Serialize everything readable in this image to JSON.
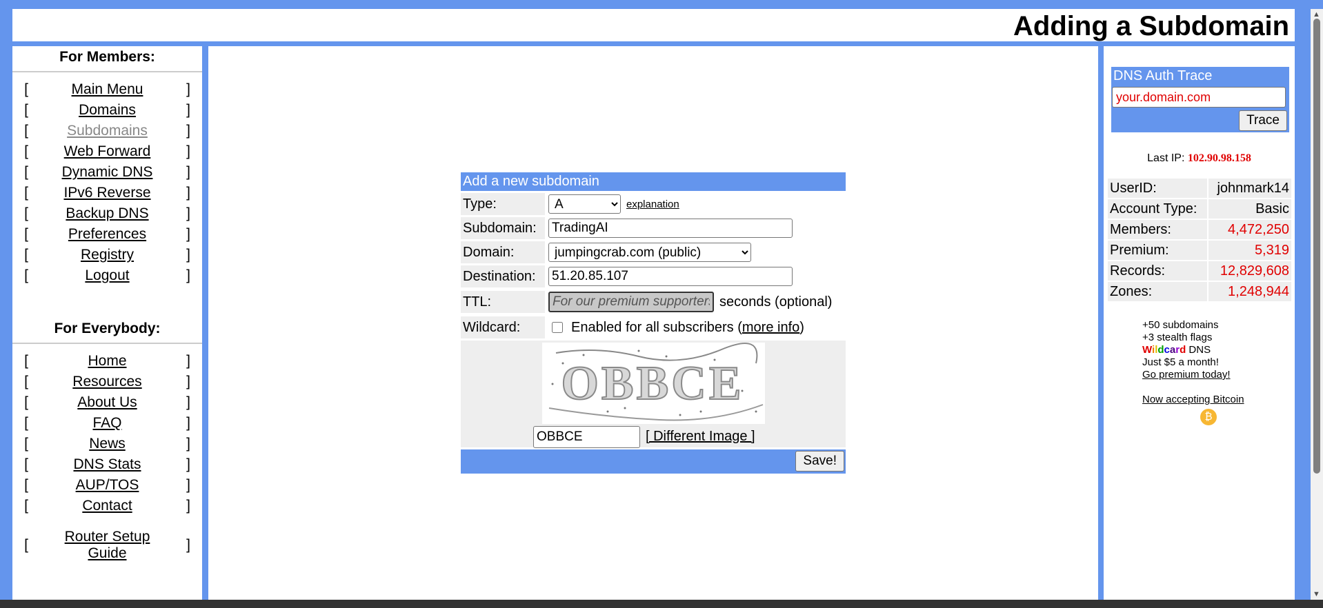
{
  "page_title": "Adding a Subdomain",
  "members_heading": "For Members:",
  "members_nav": [
    {
      "label": "Main Menu"
    },
    {
      "label": "Domains"
    },
    {
      "label": "Subdomains"
    },
    {
      "label": "Web Forward"
    },
    {
      "label": "Dynamic DNS"
    },
    {
      "label": "IPv6 Reverse"
    },
    {
      "label": "Backup DNS"
    },
    {
      "label": "Preferences"
    },
    {
      "label": "Registry"
    },
    {
      "label": "Logout"
    }
  ],
  "everybody_heading": "For Everybody:",
  "everybody_nav": [
    {
      "label": "Home"
    },
    {
      "label": "Resources"
    },
    {
      "label": "About Us"
    },
    {
      "label": "FAQ"
    },
    {
      "label": "News"
    },
    {
      "label": "DNS Stats"
    },
    {
      "label": "AUP/TOS"
    },
    {
      "label": "Contact"
    },
    {
      "label": "Router Setup Guide"
    }
  ],
  "bracket_open": "[",
  "bracket_close": "]",
  "form": {
    "header": "Add a new subdomain",
    "type_label": "Type:",
    "type_value": "A",
    "explanation_link": "explanation",
    "subdomain_label": "Subdomain:",
    "subdomain_value": "TradingAI",
    "domain_label": "Domain:",
    "domain_value": "jumpingcrab.com (public)",
    "destination_label": "Destination:",
    "destination_value": "51.20.85.107",
    "ttl_label": "TTL:",
    "ttl_value": "For our premium supporters",
    "ttl_suffix": "seconds (optional)",
    "wildcard_label": "Wildcard:",
    "wildcard_text": "Enabled for all subscribers (",
    "wildcard_more": "more info",
    "wildcard_close": ")",
    "captcha_text": "OBBCE",
    "captcha_value": "OBBCE",
    "different_image": "[ Different Image ]",
    "save_label": "Save!"
  },
  "trace": {
    "title": "DNS Auth Trace",
    "input_value": "your.domain.com",
    "button": "Trace"
  },
  "last_ip_label": "Last IP:",
  "last_ip_value": "102.90.98.158",
  "stats": [
    {
      "label": "UserID:",
      "value": "johnmark14",
      "color": "#000000"
    },
    {
      "label": "Account Type:",
      "value": "Basic",
      "color": "#000000"
    },
    {
      "label": "Members:",
      "value": "4,472,250",
      "color": "#e00000"
    },
    {
      "label": "Premium:",
      "value": "5,319",
      "color": "#e00000"
    },
    {
      "label": "Records:",
      "value": "12,829,608",
      "color": "#e00000"
    },
    {
      "label": "Zones:",
      "value": "1,248,944",
      "color": "#e00000"
    }
  ],
  "promo": {
    "line1": "+50 subdomains",
    "line2": "+3 stealth flags",
    "wildcard_word": "Wildcard",
    "dns_word": " DNS",
    "line4": "Just $5 a month!",
    "link": "Go premium today!",
    "bitcoin": "Now accepting Bitcoin",
    "bitcoin_icon": "bitcoin-icon"
  },
  "colors": {
    "frame": "#6495ed",
    "accent_red": "#e00000",
    "cell_bg": "#eeeeee"
  }
}
